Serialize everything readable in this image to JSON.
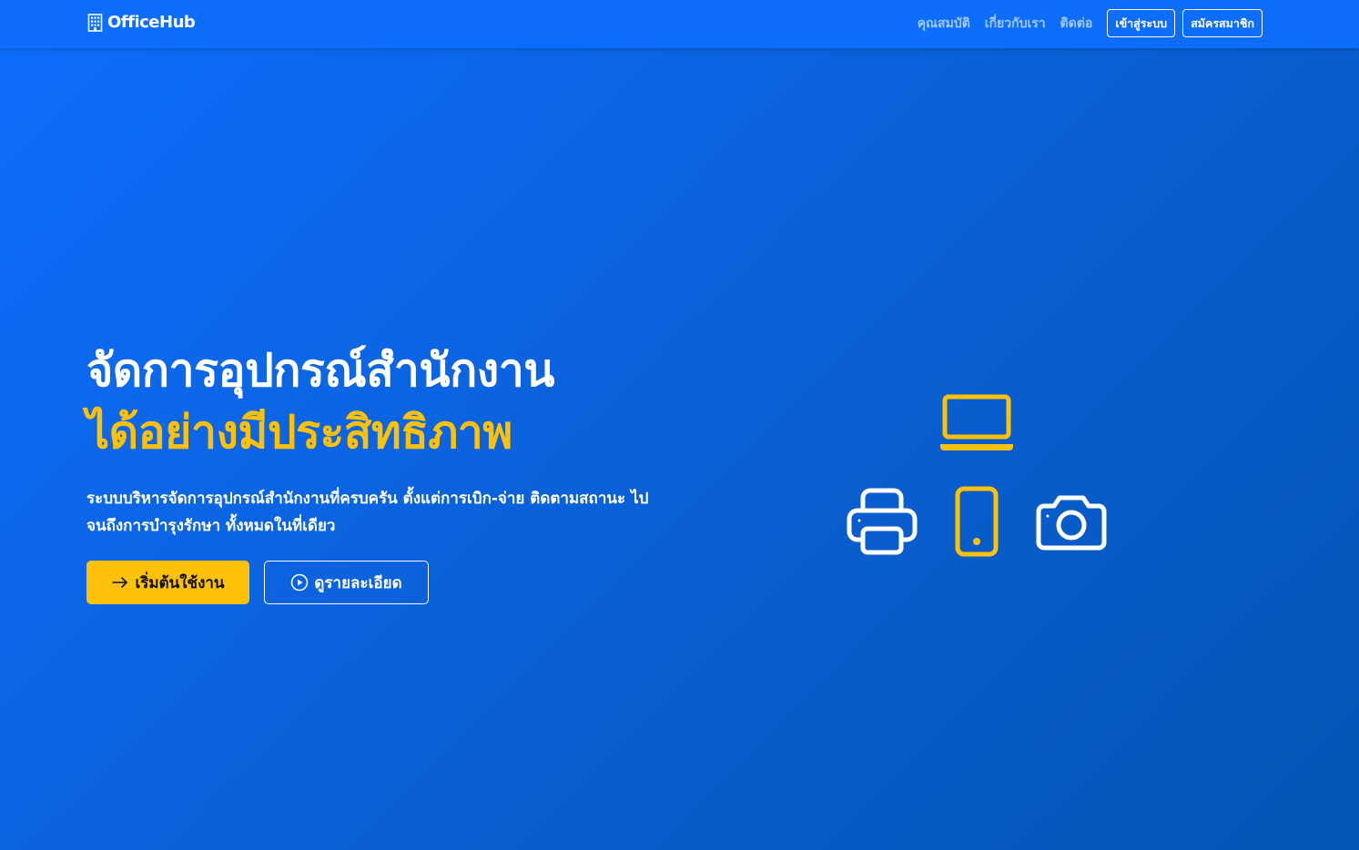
{
  "navbar": {
    "brand": "OfficeHub",
    "brand_icon": "building-icon",
    "links": [
      "คุณสมบัติ",
      "เกี่ยวกับเรา",
      "ติดต่อ"
    ],
    "login_label": "เข้าสู่ระบบ",
    "signup_label": "สมัครสมาชิก"
  },
  "hero": {
    "title_line1": "จัดการอุปกรณ์สำนักงาน",
    "title_line2": "ได้อย่างมีประสิทธิภาพ",
    "description": "ระบบบริหารจัดการอุปกรณ์สำนักงานที่ครบครัน ตั้งแต่การเบิก-จ่าย ติดตามสถานะ ไปจนถึงการบำรุงรักษา ทั้งหมดในที่เดียว",
    "start_label": "เริ่มต้นใช้งาน",
    "start_icon": "arrow-right-icon",
    "detail_label": "ดูรายละเอียด",
    "detail_icon": "play-circle-icon"
  },
  "illustration": {
    "icons": [
      "laptop-icon",
      "printer-icon",
      "phone-icon",
      "camera-icon"
    ]
  },
  "colors": {
    "primary": "#0d6efd",
    "accent": "#ffc107",
    "text_light": "#ffffff"
  }
}
